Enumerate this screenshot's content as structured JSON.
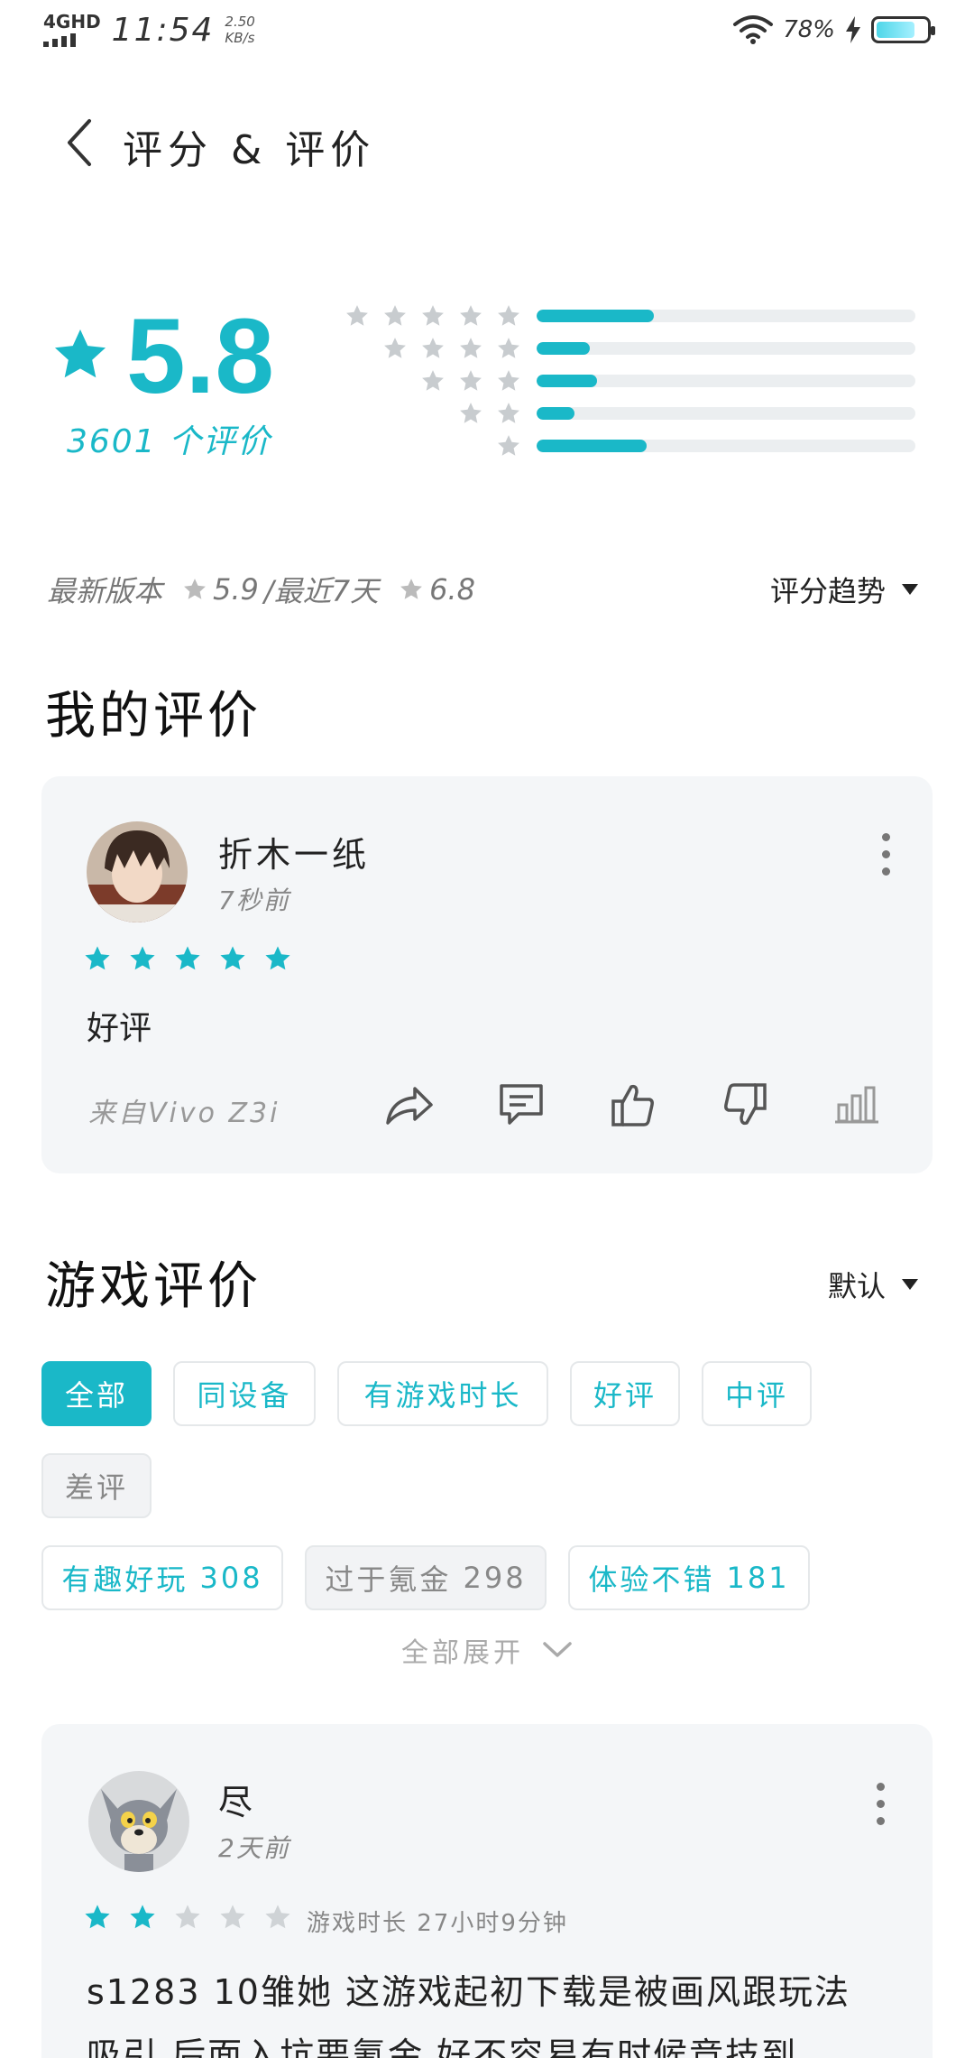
{
  "status_bar": {
    "network": "4GHD",
    "time": "11:54",
    "speed_value": "2.50",
    "speed_unit": "KB/s",
    "battery": "78%",
    "battery_level": 0.78
  },
  "header": {
    "title": "评分 & 评价"
  },
  "summary": {
    "score": "5.8",
    "count_label": "3601 个评价",
    "distribution": [
      {
        "stars": 5,
        "fraction": 0.31
      },
      {
        "stars": 4,
        "fraction": 0.14
      },
      {
        "stars": 3,
        "fraction": 0.16
      },
      {
        "stars": 2,
        "fraction": 0.1
      },
      {
        "stars": 1,
        "fraction": 0.29
      }
    ]
  },
  "version_info": {
    "latest_label": "最新版本",
    "latest_score": "5.9",
    "separator": "/最近7天",
    "recent_score": "6.8",
    "trend_label": "评分趋势"
  },
  "my_review": {
    "section_title": "我的评价",
    "user_name": "折木一纸",
    "time": "7秒前",
    "rating": 5,
    "body": "好评",
    "device": "来自Vivo Z3i"
  },
  "game_reviews": {
    "section_title": "游戏评价",
    "sort_label": "默认",
    "filters": [
      "全部",
      "同设备",
      "有游戏时长",
      "好评",
      "中评",
      "差评"
    ],
    "tags": [
      {
        "label": "有趣好玩",
        "count": "308"
      },
      {
        "label": "过于氪金",
        "count": "298"
      },
      {
        "label": "体验不错",
        "count": "181"
      }
    ],
    "expand_label": "全部展开"
  },
  "review_item": {
    "user_name": "尽",
    "time": "2天前",
    "rating": 2,
    "playtime": "游戏时长 27小时9分钟",
    "body_line1": "s1283 10雏她 这游戏起初下载是被画风跟玩法",
    "body_line2": "吸引 后面入坑要氪金 好不容易有时候竞技到"
  },
  "colors": {
    "accent": "#1ab8c8",
    "star_empty": "#cfd3d6",
    "card_bg": "#f4f6f8"
  }
}
